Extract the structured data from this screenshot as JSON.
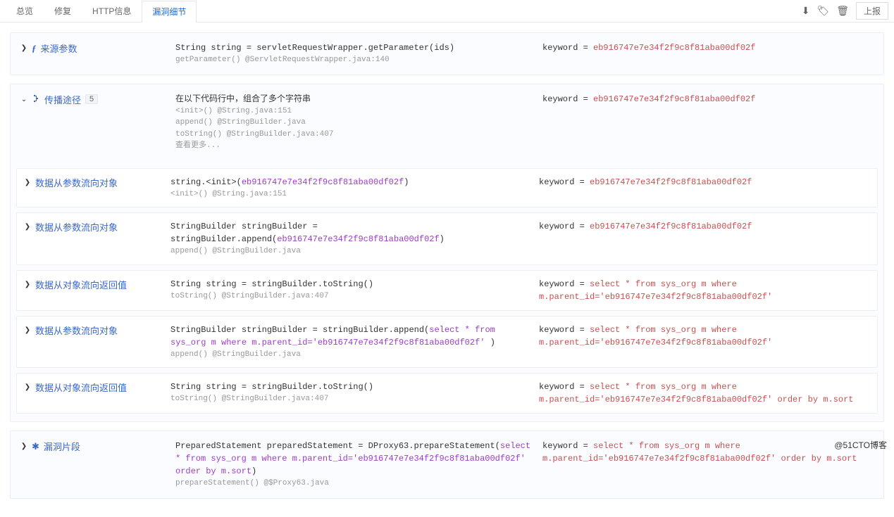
{
  "tabs": [
    "总览",
    "修复",
    "HTTP信息",
    "漏洞细节"
  ],
  "active_tab": 3,
  "actions": {
    "download": "⬇",
    "tag": "🏷",
    "delete": "🗑",
    "report": "上报"
  },
  "source": {
    "title": "来源参数",
    "code_pre": "String string = servletRequestWrapper.getParameter(ids)",
    "meta": "getParameter() @ServletRequestWrapper.java:140",
    "kw_label": "keyword = ",
    "kw_value": "eb916747e7e34f2f9c8f81aba00df02f"
  },
  "propagation": {
    "title": "传播途径",
    "count": "5",
    "summary_title": "在以下代码行中，组合了多个字符串",
    "summary_lines": [
      "<init>() @String.java:151",
      "append() @StringBuilder.java",
      "toString() @StringBuilder.java:407",
      "查看更多..."
    ],
    "kw_label": "keyword = ",
    "kw_value": "eb916747e7e34f2f9c8f81aba00df02f",
    "items": [
      {
        "title": "数据从参数流向对象",
        "code_pre": "string.<init>(",
        "code_val": "eb916747e7e34f2f9c8f81aba00df02f",
        "code_post": ")",
        "meta": "<init>() @String.java:151",
        "kw_label": "keyword = ",
        "kw_value": "eb916747e7e34f2f9c8f81aba00df02f"
      },
      {
        "title": "数据从参数流向对象",
        "code_pre": "StringBuilder stringBuilder = stringBuilder.append(",
        "code_val": "eb916747e7e34f2f9c8f81aba00df02f",
        "code_post": ")",
        "meta": "append() @StringBuilder.java",
        "kw_label": "keyword = ",
        "kw_value": "eb916747e7e34f2f9c8f81aba00df02f"
      },
      {
        "title": "数据从对象流向返回值",
        "code_pre": "String string = stringBuilder.toString()",
        "code_val": "",
        "code_post": "",
        "meta": "toString() @StringBuilder.java:407",
        "kw_label": "keyword = ",
        "kw_value": "select * from sys_org m where m.parent_id='eb916747e7e34f2f9c8f81aba00df02f'"
      },
      {
        "title": "数据从参数流向对象",
        "code_pre": "StringBuilder stringBuilder = stringBuilder.append(",
        "code_val": "select * from sys_org m where m.parent_id='eb916747e7e34f2f9c8f81aba00df02f' ",
        "code_post": ")",
        "meta": "append() @StringBuilder.java",
        "kw_label": "keyword = ",
        "kw_value": "select * from sys_org m where m.parent_id='eb916747e7e34f2f9c8f81aba00df02f'"
      },
      {
        "title": "数据从对象流向返回值",
        "code_pre": "String string = stringBuilder.toString()",
        "code_val": "",
        "code_post": "",
        "meta": "toString() @StringBuilder.java:407",
        "kw_label": "keyword = ",
        "kw_value": "select * from sys_org m where m.parent_id='eb916747e7e34f2f9c8f81aba00df02f' order by m.sort"
      }
    ]
  },
  "fragment": {
    "title": "漏洞片段",
    "code_pre": "PreparedStatement preparedStatement = DProxy63.prepareStatement(",
    "code_val": "select * from sys_org m where m.parent_id='eb916747e7e34f2f9c8f81aba00df02f' order by m.sort",
    "code_post": ")",
    "meta": "prepareStatement() @$Proxy63.java",
    "kw_label": "keyword = ",
    "kw_value": "select * from sys_org m where m.parent_id='eb916747e7e34f2f9c8f81aba00df02f' order by m.sort"
  },
  "watermark": "@51CTO博客"
}
